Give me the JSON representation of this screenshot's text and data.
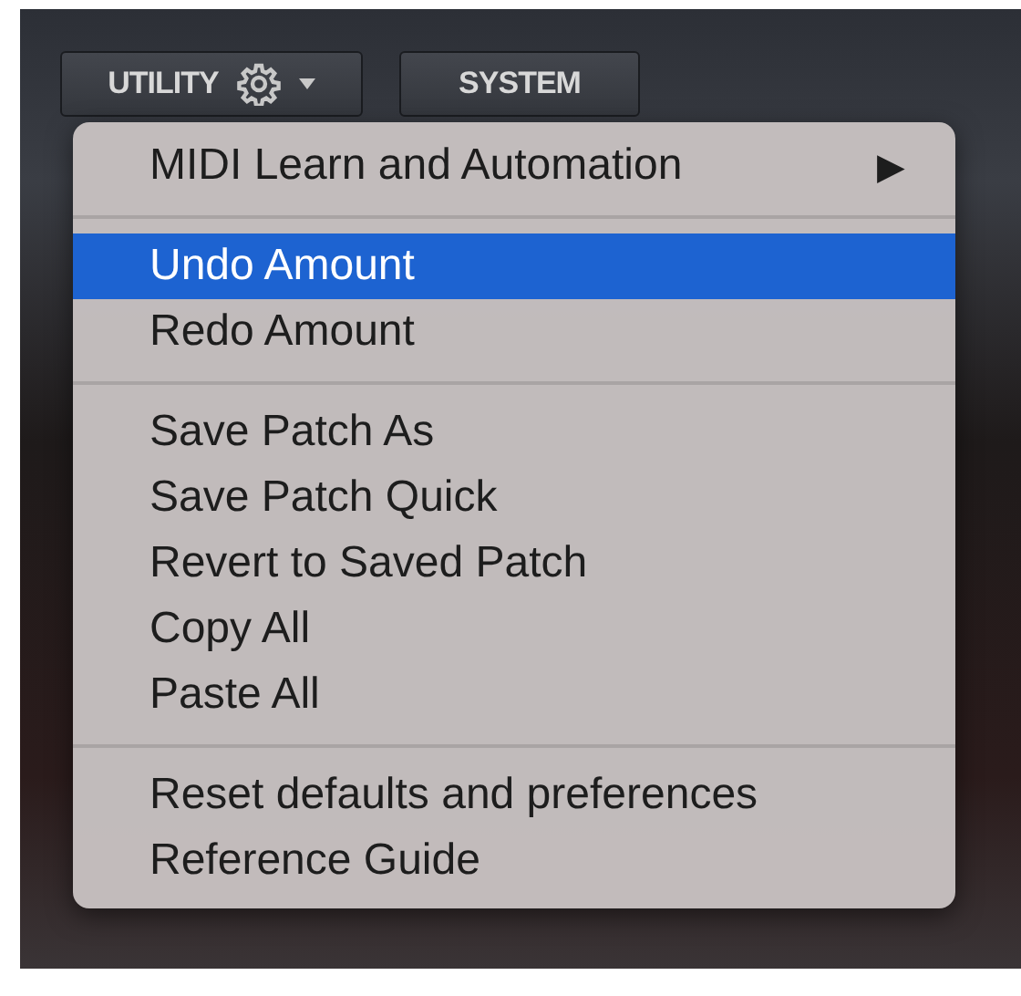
{
  "toolbar": {
    "buttons": [
      {
        "label": "UTILITY",
        "kind": "dropdown"
      },
      {
        "label": "SYSTEM",
        "kind": "plain"
      }
    ]
  },
  "menu": {
    "sections": [
      {
        "items": [
          {
            "label": "MIDI Learn and Automation",
            "submenu_arrow": "▶",
            "selected": false
          }
        ]
      },
      {
        "items": [
          {
            "label": "Undo Amount",
            "selected": true
          },
          {
            "label": "Redo Amount",
            "selected": false
          }
        ]
      },
      {
        "items": [
          {
            "label": "Save Patch As",
            "selected": false
          },
          {
            "label": "Save Patch Quick",
            "selected": false
          },
          {
            "label": "Revert to Saved Patch",
            "selected": false
          },
          {
            "label": "Copy All",
            "selected": false
          },
          {
            "label": "Paste All",
            "selected": false
          }
        ]
      },
      {
        "items": [
          {
            "label": "Reset defaults and preferences",
            "selected": false
          },
          {
            "label": "Reference Guide",
            "selected": false
          }
        ]
      }
    ]
  }
}
